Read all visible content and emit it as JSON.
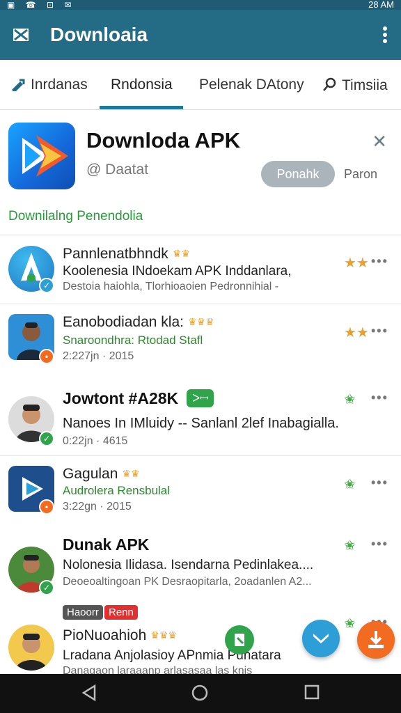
{
  "status": {
    "left_icons": "▣ ☎ ⊡ ✉",
    "right": "28 AM"
  },
  "app_bar": {
    "title": "Downloaia",
    "mail_icon": "mail-icon",
    "more_icon": "more-vertical-icon"
  },
  "tabs": [
    {
      "label": "Inrdanas"
    },
    {
      "label": "Rndonsia"
    },
    {
      "label": "Pelenak DAtony"
    },
    {
      "label": "Timsiia"
    }
  ],
  "hero": {
    "app_name": "Downloda APK",
    "developer": "@ Daatat",
    "primary_button": "Ponahk",
    "secondary_button": "Paron",
    "section_title": "Downilalng Penendolia"
  },
  "rows": [
    {
      "title": "Pannlenatbhndk",
      "subtitle": "Koolenesia INdoekam APK Inddanlara,",
      "meta": "Destoia haiohla, Tlorhioaoien Pedronnihial -",
      "star": "★★",
      "more": "•••"
    },
    {
      "title": "Eanobodiadan kla:",
      "subtitle": "Snaroondhra: Rtodad Stafl",
      "meta": "2:227jn · 2015",
      "star": "★★",
      "more": "•••"
    },
    {
      "title": "Jowtont #A28K",
      "chip": "ᐳꟷ",
      "subtitle": "Nanoes In IMluidy -- Sanlanl 2lef Inabagialla.",
      "meta": "0:22jn · 4615",
      "star": "✬",
      "more": "•••"
    },
    {
      "title": "Gagulan",
      "subtitle": "Audrolera Rensbulal",
      "meta": "3:22gn · 2015",
      "star": "✬",
      "more": "•••"
    },
    {
      "title": "Dunak APK",
      "subtitle": "Nolonesia Ilidasa. Isendarna Pedinlakea....",
      "meta": "Deoeoaltingoan PK Desraopitarla, 2oadanlen A2...",
      "star": "✬",
      "more": "•••"
    },
    {
      "chip1": "Haoorr",
      "chip2": "Renn",
      "title": "PioNuoahioh",
      "subtitle": "Lradana Anjolasioy APnmia Punatara",
      "meta": "Danagaon laraaanp arlasasaa las knis",
      "star": "✬",
      "more": "•••"
    }
  ]
}
